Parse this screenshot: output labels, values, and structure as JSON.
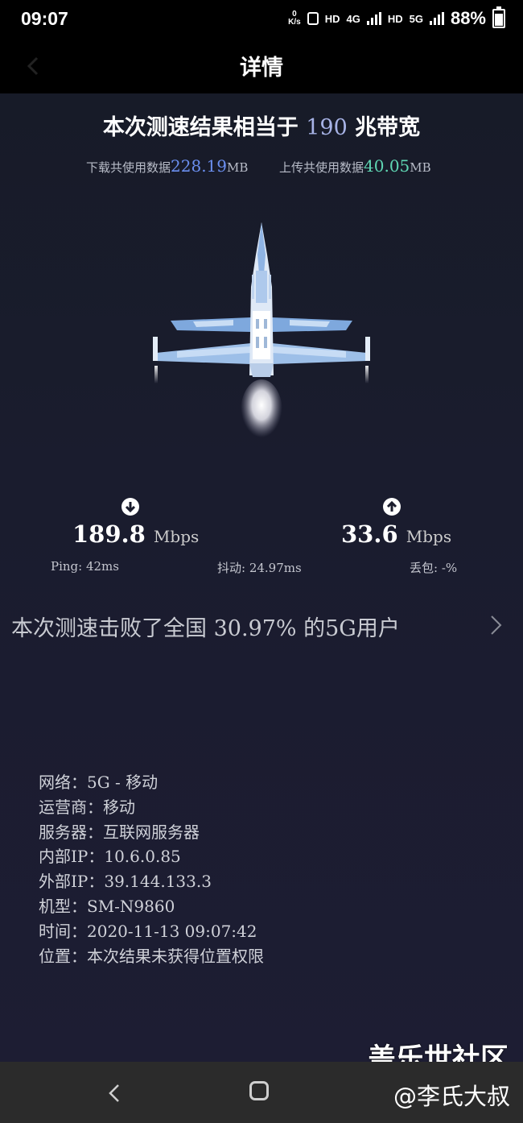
{
  "status_bar": {
    "time": "09:07",
    "net_speed_value": "0",
    "net_speed_unit": "K/s",
    "hd1": "HD",
    "tag_4g": "4G",
    "hd2": "HD",
    "tag_5g": "5G",
    "battery": "88%"
  },
  "header": {
    "title": "详情",
    "back_icon": "back-arrow-icon"
  },
  "result": {
    "prefix": "本次测速结果相当于",
    "bandwidth": "190",
    "suffix": "兆带宽",
    "download_usage_label": "下载共使用数据",
    "download_usage_value": "228.19",
    "download_usage_unit": "MB",
    "upload_usage_label": "上传共使用数据",
    "upload_usage_value": "40.05",
    "upload_usage_unit": "MB"
  },
  "speeds": {
    "download_value": "189.8",
    "download_unit": "Mbps",
    "upload_value": "33.6",
    "upload_unit": "Mbps",
    "ping": "Ping: 42ms",
    "jitter": "抖动: 24.97ms",
    "loss": "丢包: -%"
  },
  "beat_text": "本次测速击败了全国 30.97% 的5G用户",
  "info": {
    "network": "网络：5G - 移动",
    "carrier": "运营商：移动",
    "server": "服务器：互联网服务器",
    "internal_ip": "内部IP：10.6.0.85",
    "external_ip": "外部IP：39.144.133.3",
    "model": "机型：SM-N9860",
    "time": "时间：2020-11-13 09:07:42",
    "location": "位置：本次结果未获得位置权限"
  },
  "watermark": {
    "line1": "盖乐世社区",
    "line2": "@李氏大叔"
  },
  "colors": {
    "download_accent": "#6b8ff0",
    "upload_accent": "#5fd6b3",
    "bandwidth_accent": "#a7b3e6"
  }
}
